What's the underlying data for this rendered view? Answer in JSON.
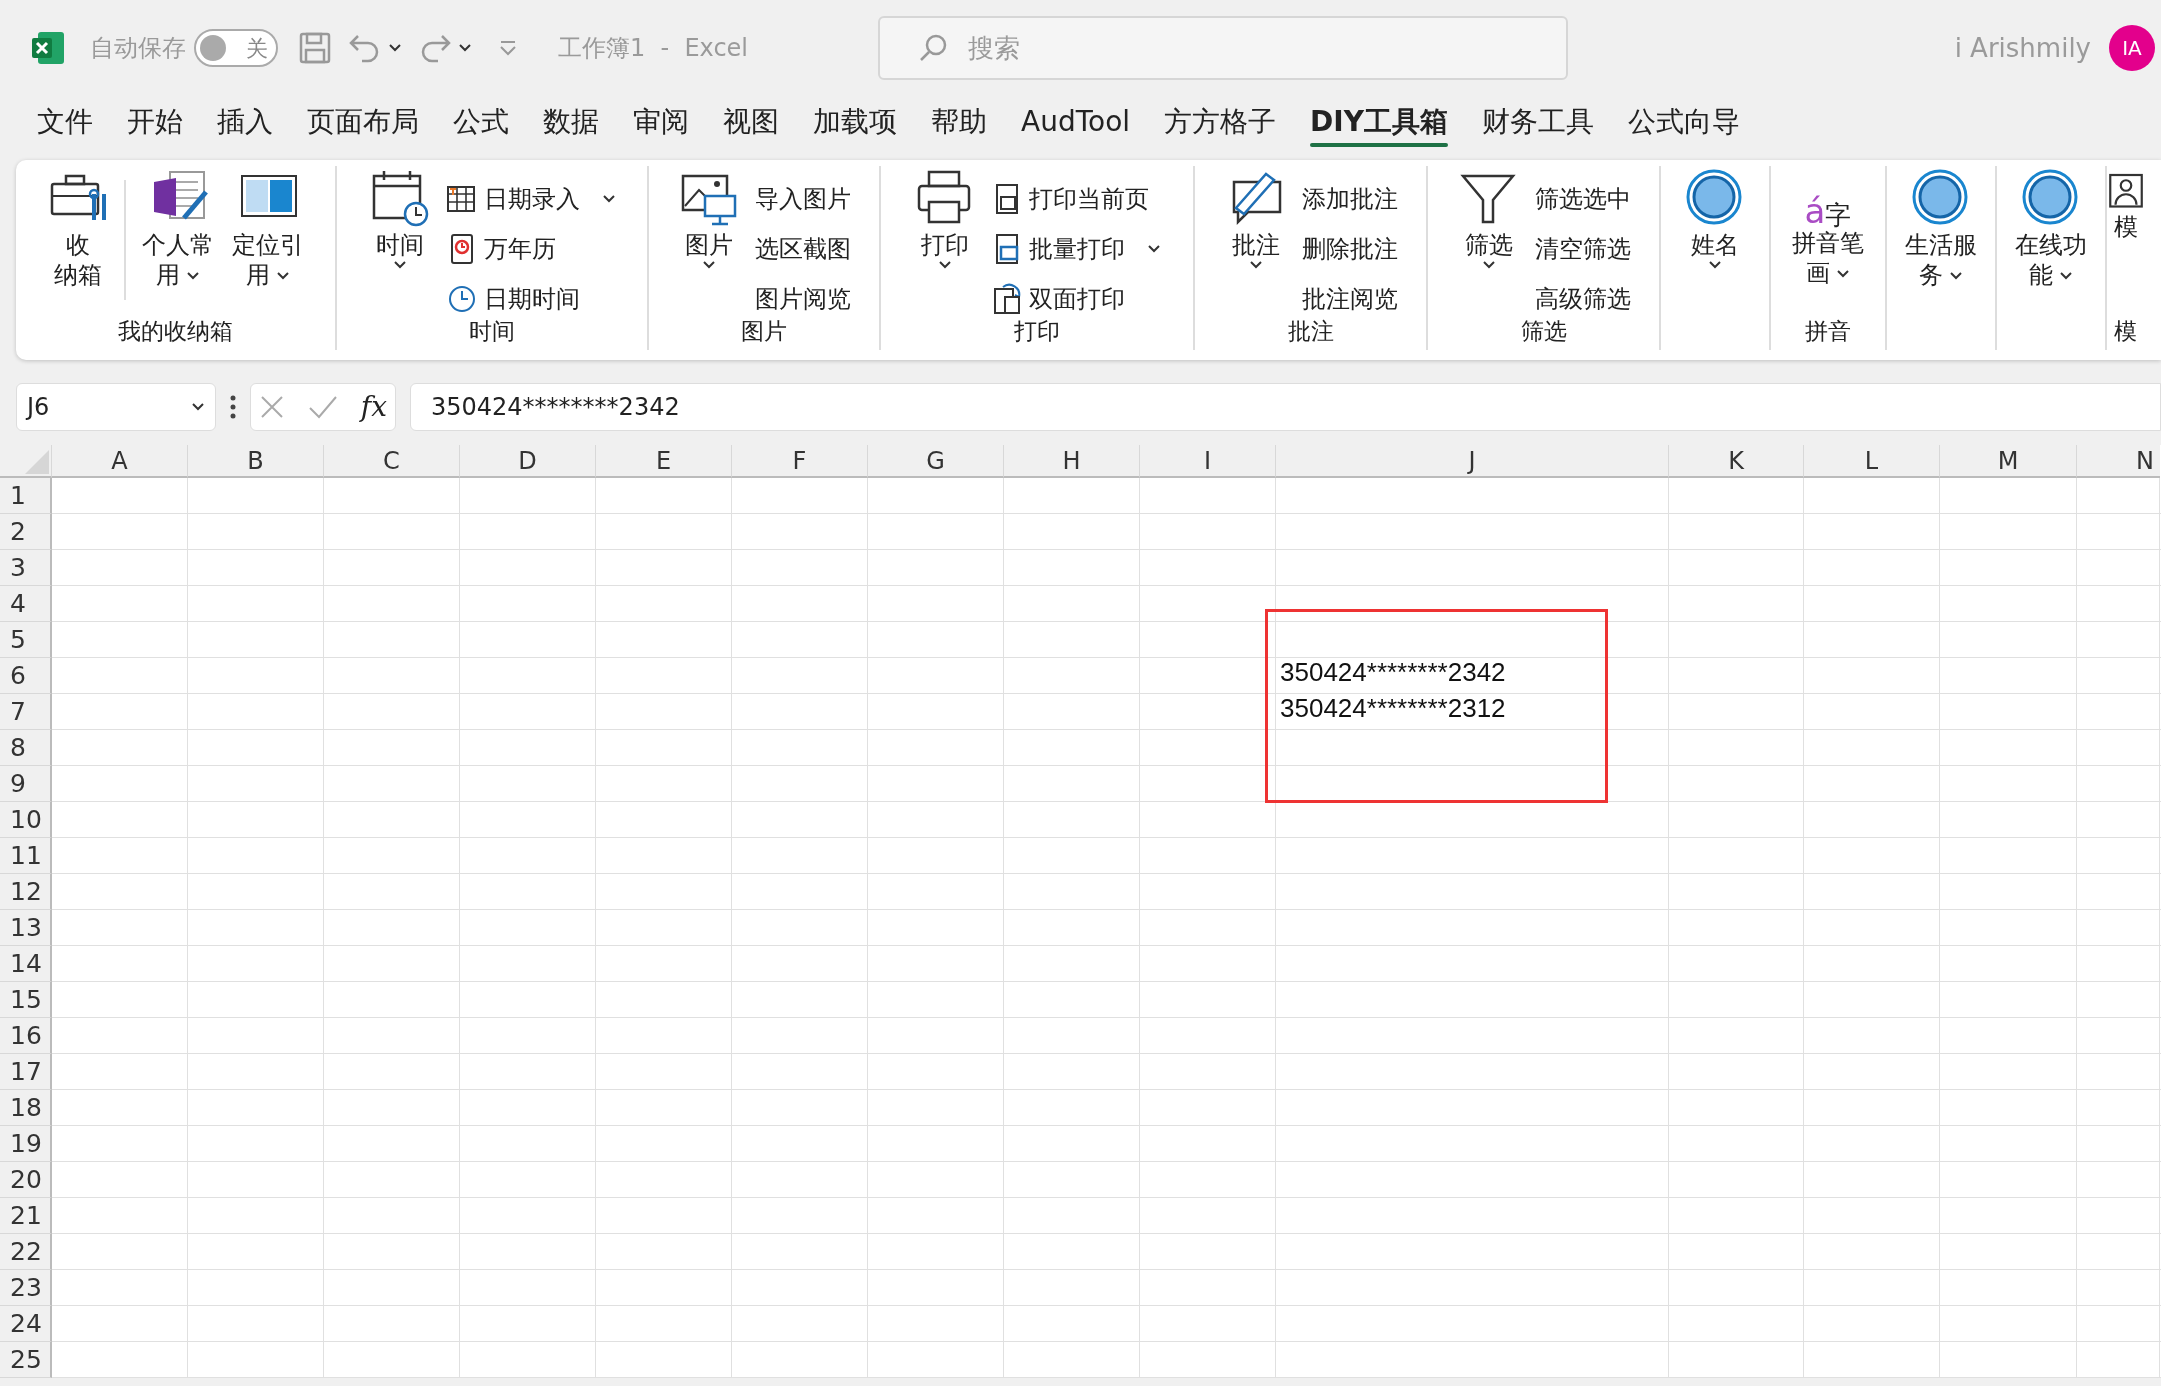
{
  "window": {
    "autosave_label": "自动保存",
    "autosave_toggle": {
      "label": "关",
      "on": false
    },
    "title": "工作簿1  -  Excel",
    "search": {
      "placeholder": "搜索"
    },
    "user": "i Arishmily",
    "avatar": "IA"
  },
  "tabs": [
    {
      "label": "文件",
      "selected": false
    },
    {
      "label": "开始",
      "selected": false
    },
    {
      "label": "插入",
      "selected": false
    },
    {
      "label": "页面布局",
      "selected": false
    },
    {
      "label": "公式",
      "selected": false
    },
    {
      "label": "数据",
      "selected": false
    },
    {
      "label": "审阅",
      "selected": false
    },
    {
      "label": "视图",
      "selected": false
    },
    {
      "label": "加载项",
      "selected": false
    },
    {
      "label": "帮助",
      "selected": false
    },
    {
      "label": "AudTool",
      "selected": false
    },
    {
      "label": "方方格子",
      "selected": false
    },
    {
      "label": "DIY工具箱",
      "selected": true
    },
    {
      "label": "财务工具",
      "selected": false
    },
    {
      "label": "公式向导",
      "selected": false
    }
  ],
  "ribbon": [
    {
      "label": "我的收纳箱",
      "buttons": [
        {
          "kind": "large",
          "label": "收纳箱",
          "dropdown": false
        },
        {
          "kind": "separator"
        },
        {
          "kind": "large",
          "label": "个人常用",
          "dropdown": true
        },
        {
          "kind": "large",
          "label": "定位引用",
          "dropdown": true
        }
      ]
    },
    {
      "label": "时间",
      "buttons": [
        {
          "kind": "large",
          "label": "时间",
          "dropdown": true
        }
      ],
      "items": [
        {
          "label": "日期录入",
          "dropdown": true
        },
        {
          "label": "万年历",
          "dropdown": false
        },
        {
          "label": "日期时间",
          "dropdown": false
        }
      ]
    },
    {
      "label": "图片",
      "buttons": [
        {
          "kind": "large",
          "label": "图片",
          "dropdown": true
        }
      ],
      "items": [
        {
          "label": "导入图片",
          "dropdown": false
        },
        {
          "label": "选区截图",
          "dropdown": false
        },
        {
          "label": "图片阅览",
          "dropdown": false
        }
      ]
    },
    {
      "label": "打印",
      "buttons": [
        {
          "kind": "large",
          "label": "打印",
          "dropdown": true
        }
      ],
      "items": [
        {
          "label": "打印当前页",
          "dropdown": false
        },
        {
          "label": "批量打印",
          "dropdown": true
        },
        {
          "label": "双面打印",
          "dropdown": false
        }
      ]
    },
    {
      "label": "批注",
      "buttons": [
        {
          "kind": "large",
          "label": "批注",
          "dropdown": true
        }
      ],
      "items": [
        {
          "label": "添加批注",
          "dropdown": false
        },
        {
          "label": "删除批注",
          "dropdown": false
        },
        {
          "label": "批注阅览",
          "dropdown": false
        }
      ]
    },
    {
      "label": "筛选",
      "buttons": [
        {
          "kind": "large",
          "label": "筛选",
          "dropdown": true
        }
      ],
      "items": [
        {
          "label": "筛选选中",
          "dropdown": false
        },
        {
          "label": "清空筛选",
          "dropdown": false
        },
        {
          "label": "高级筛选",
          "dropdown": false
        }
      ]
    },
    {
      "buttons": [
        {
          "kind": "large",
          "label": "姓名",
          "dropdown": true
        }
      ]
    },
    {
      "label": "拼音",
      "buttons": [
        {
          "kind": "large",
          "label": "拼音笔画",
          "dropdown": true,
          "glyph": [
            "á",
            "字"
          ]
        }
      ]
    },
    {
      "buttons": [
        {
          "kind": "large",
          "label": "生活服务",
          "dropdown": true
        }
      ]
    },
    {
      "buttons": [
        {
          "kind": "large",
          "label": "在线功能",
          "dropdown": true
        }
      ]
    },
    {
      "label": "模",
      "buttons": [
        {
          "kind": "large",
          "label": "模",
          "dropdown": false
        }
      ]
    }
  ],
  "formula_bar": {
    "name_box": "J6",
    "function_label": "fx",
    "formula": "350424********2342"
  },
  "sheet": {
    "columns": [
      "A",
      "B",
      "C",
      "D",
      "E",
      "F",
      "G",
      "H",
      "I",
      "J",
      "K",
      "L",
      "M",
      "N"
    ],
    "rows": [
      {
        "label": "1"
      },
      {
        "label": "2"
      },
      {
        "label": "3"
      },
      {
        "label": "4"
      },
      {
        "label": "5"
      },
      {
        "label": "6",
        "cells": [
          {
            "value": "350424********2342"
          }
        ]
      },
      {
        "label": "7",
        "cells": [
          {
            "value": "350424********2312"
          }
        ]
      },
      {
        "label": "8"
      },
      {
        "label": "9"
      },
      {
        "label": "10"
      },
      {
        "label": "11"
      },
      {
        "label": "12"
      },
      {
        "label": "13"
      },
      {
        "label": "14"
      },
      {
        "label": "15"
      },
      {
        "label": "16"
      },
      {
        "label": "17"
      },
      {
        "label": "18"
      },
      {
        "label": "19"
      },
      {
        "label": "20"
      },
      {
        "label": "21"
      },
      {
        "label": "22"
      },
      {
        "label": "23"
      },
      {
        "label": "24"
      },
      {
        "label": "25"
      }
    ]
  }
}
